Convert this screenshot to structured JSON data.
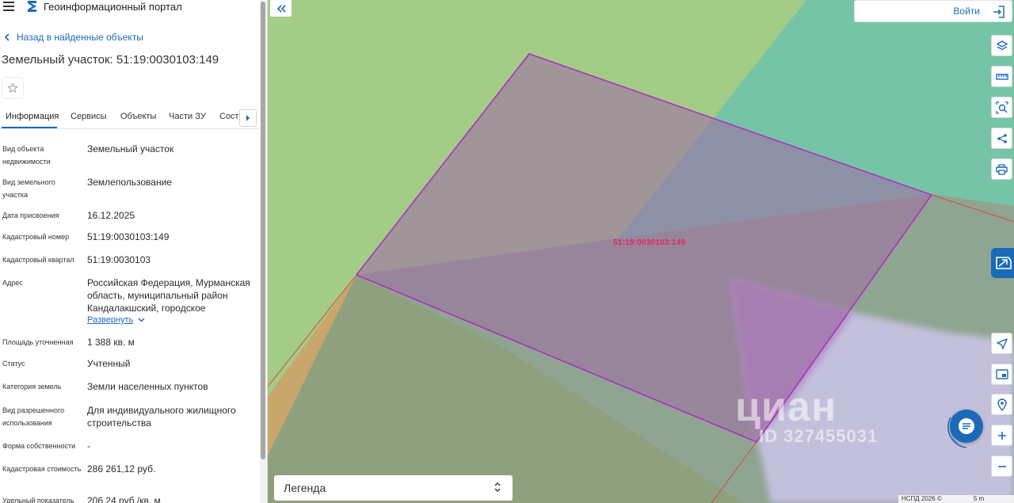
{
  "header": {
    "portal_title": "Геоинформационный портал"
  },
  "panel": {
    "back_label": "Назад в найденные объекты",
    "title": "Земельный участок: 51:19:0030103:149",
    "tabs": [
      {
        "label": "Информация",
        "active": true
      },
      {
        "label": "Сервисы"
      },
      {
        "label": "Объекты"
      },
      {
        "label": "Части ЗУ"
      },
      {
        "label": "Соста"
      }
    ],
    "properties": [
      {
        "label": "Вид объекта недвижимости",
        "value": "Земельный участок"
      },
      {
        "label": "Вид земельного участка",
        "value": "Землепользование"
      },
      {
        "label": "Дата присвоения",
        "value": "16.12.2025"
      },
      {
        "label": "Кадастровый номер",
        "value": "51:19:0030103:149"
      },
      {
        "label": "Кадастровый квартал",
        "value": "51:19:0030103"
      },
      {
        "label": "Адрес",
        "value": "Российская Федерация, Мурманская область, муниципальный район Кандалакшский, городское",
        "expand_label": "Развернуть"
      },
      {
        "label": "Площадь уточненная",
        "value": "1 388 кв. м"
      },
      {
        "label": "Статус",
        "value": "Учтенный"
      },
      {
        "label": "Категория земель",
        "value": "Земли населенных пунктов"
      },
      {
        "label": "Вид разрешенного использования",
        "value": "Для индивидуального жилищного строительства"
      },
      {
        "label": "Форма собственности",
        "value": "-"
      },
      {
        "label": "Кадастровая стоимость",
        "value": "286 261,12 руб."
      },
      {
        "label": "Удельный показатель",
        "value": "206,24 руб./кв. м"
      }
    ]
  },
  "map": {
    "login_label": "Войти",
    "parcel_label": "51:19:0030103:149",
    "legend_label": "Легенда",
    "watermark_main": "циан",
    "watermark_id": "ID 327455031",
    "attribution": "НСПД 2026 ©",
    "scale_label": "5 m",
    "tools": [
      {
        "icon": "layers-icon"
      },
      {
        "icon": "ruler-icon"
      },
      {
        "icon": "area-search-icon"
      },
      {
        "icon": "share-icon"
      },
      {
        "icon": "print-icon"
      },
      {
        "icon": "navigation-icon"
      },
      {
        "icon": "minimap-icon"
      },
      {
        "icon": "location-pin-icon"
      },
      {
        "icon": "zoom-in-icon"
      },
      {
        "icon": "zoom-out-icon"
      }
    ],
    "colors": {
      "accent": "#1b6ab8",
      "parcel_outline": "#b02cc4",
      "parcel_label": "#e0245e"
    }
  }
}
